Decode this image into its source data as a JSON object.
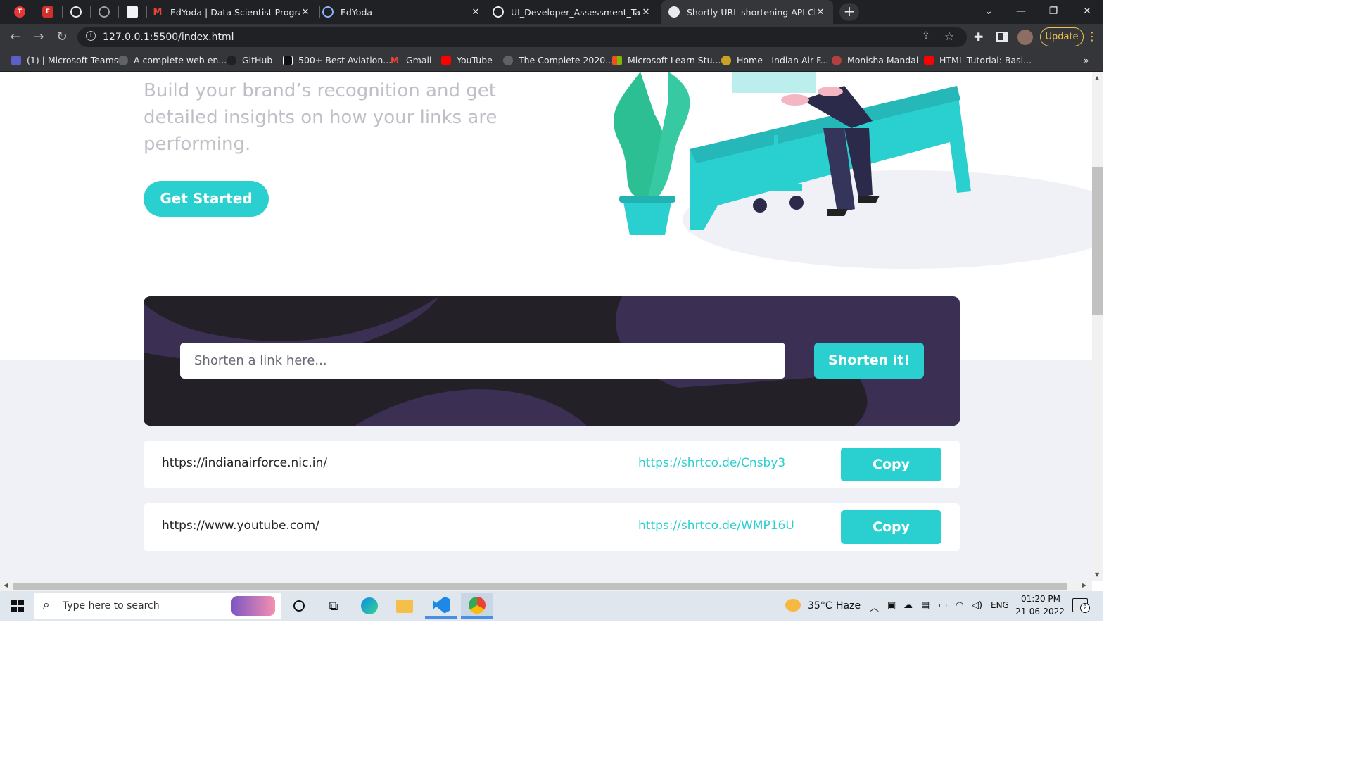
{
  "browser": {
    "tabs": [
      {
        "title": "",
        "icon": "tuf-icon",
        "color": "#e53935"
      },
      {
        "title": "",
        "icon": "tf-icon",
        "color": "#d32f2f"
      },
      {
        "title": "",
        "icon": "globe-icon",
        "color": "#9aa0a6"
      },
      {
        "title": "",
        "icon": "globe-icon",
        "color": "#9aa0a6"
      },
      {
        "title": "",
        "icon": "page-icon",
        "color": "#9aa0a6"
      },
      {
        "title": "EdYoda | Data Scientist Program |",
        "icon": "gmail-icon",
        "color": "#ea4335"
      },
      {
        "title": "EdYoda",
        "icon": "edyoda-icon",
        "color": "#4285f4"
      },
      {
        "title": "UI_Developer_Assessment_Task.p",
        "icon": "globe-icon",
        "color": "#9aa0a6"
      },
      {
        "title": "Shortly URL shortening API Chall",
        "icon": "globe-icon",
        "color": "#9aa0a6"
      }
    ],
    "url": "127.0.0.1:5500/index.html",
    "update_label": "Update",
    "bookmarks": [
      {
        "label": "(1) | Microsoft Teams",
        "color": "#5b5fc7"
      },
      {
        "label": "A complete web en...",
        "color": "#9aa0a6"
      },
      {
        "label": "GitHub",
        "color": "#202124"
      },
      {
        "label": "500+ Best Aviation...",
        "color": "#ffffff"
      },
      {
        "label": "Gmail",
        "color": "#ea4335"
      },
      {
        "label": "YouTube",
        "color": "#ff0000"
      },
      {
        "label": "The Complete 2020...",
        "color": "#9aa0a6"
      },
      {
        "label": "Microsoft Learn Stu...",
        "color": "#f25022"
      },
      {
        "label": "Home - Indian Air F...",
        "color": "#c9a227"
      },
      {
        "label": "Monisha Mandal",
        "color": "#b0413e"
      },
      {
        "label": "HTML Tutorial: Basi...",
        "color": "#ff0000"
      }
    ],
    "bookmarks_more": "»"
  },
  "hero": {
    "text": "Build your brand’s recognition and get detailed insights on how your links are performing.",
    "cta": "Get Started"
  },
  "shorten": {
    "placeholder": "Shorten a link here...",
    "button": "Shorten it!"
  },
  "results": [
    {
      "original": "https://indianairforce.nic.in/",
      "short": "https://shrtco.de/Cnsby3",
      "copy": "Copy"
    },
    {
      "original": "https://www.youtube.com/",
      "short": "https://shrtco.de/WMP16U",
      "copy": "Copy"
    }
  ],
  "colors": {
    "cyan": "#2acfcf",
    "violet": "#3b3054",
    "dark": "#232127"
  },
  "taskbar": {
    "search_placeholder": "Type here to search",
    "weather_temp": "35°C",
    "weather_desc": "Haze",
    "language": "ENG",
    "time": "01:20 PM",
    "date": "21-06-2022",
    "notification_count": "2"
  }
}
